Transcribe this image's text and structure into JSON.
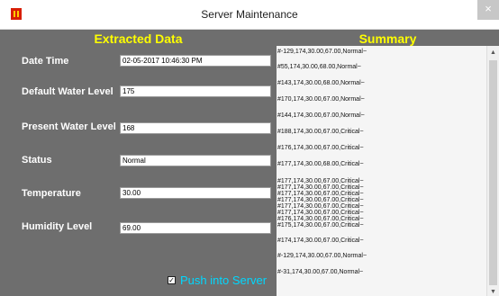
{
  "window": {
    "title": "Server Maintenance",
    "close_glyph": "×"
  },
  "left": {
    "heading": "Extracted Data",
    "fields": [
      {
        "label": "Date Time",
        "value": "02-05-2017 10:46:30 PM"
      },
      {
        "label": "Default Water Level",
        "value": "175"
      },
      {
        "label": "Present Water Level",
        "value": "168"
      },
      {
        "label": "Status",
        "value": "Normal"
      },
      {
        "label": "Temperature",
        "value": "30.00"
      },
      {
        "label": "Humidity Level",
        "value": "69.00"
      }
    ],
    "push": {
      "label": "Push into Server",
      "checked": true
    }
  },
  "right": {
    "heading": "Summary",
    "lines": [
      "#-129,174,30.00,67.00,Normal~",
      "#55,174,30.00,68.00,Normal~",
      "#143,174,30.00,68.00,Normal~",
      "#170,174,30.00,67.00,Normal~",
      "#144,174,30.00,67.00,Normal~",
      "#188,174,30.00,67.00,Critical~",
      "#176,174,30.00,67.00,Critical~",
      "#177,174,30.00,68.00,Critical~",
      "#177,174,30.00,67.00,Critical~",
      "#177,174,30.00,67.00,Critical~",
      "#177,174,30.00,67.00,Critical~",
      "#177,174,30.00,67.00,Critical~",
      "#177,174,30.00,67.00,Critical~",
      "#177,174,30.00,67.00,Critical~",
      "#176,174,30.00,67.00,Critical~",
      "#175,174,30.00,67.00,Critical~",
      "#174,174,30.00,67.00,Critical~",
      "#-129,174,30.00,67.00,Normal~",
      "#-31,174,30.00,67.00,Normal~"
    ]
  },
  "colors": {
    "panel_bg": "#6e6e6e",
    "heading": "#ffff00",
    "push_label": "#00d8ff",
    "icon_red": "#d81e05",
    "icon_yellow": "#ffcc00"
  },
  "icons": {
    "app": "app-icon",
    "close": "close-icon",
    "checkbox": "check-icon",
    "scroll_up": "chevron-up-icon",
    "scroll_down": "chevron-down-icon"
  }
}
